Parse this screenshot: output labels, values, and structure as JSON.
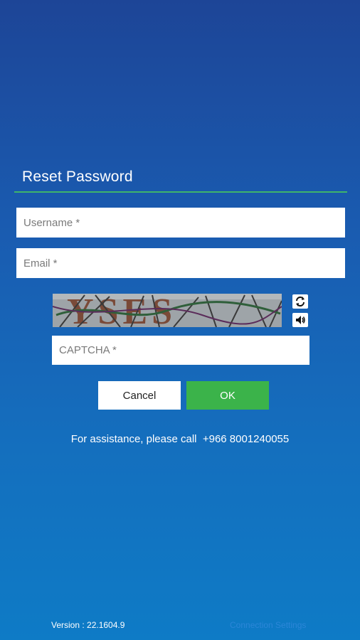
{
  "reset_form": {
    "title": "Reset Password",
    "username_placeholder": "Username *",
    "email_placeholder": "Email *",
    "captcha_placeholder": "CAPTCHA *",
    "captcha_text": "YSES",
    "cancel_label": "Cancel",
    "ok_label": "OK"
  },
  "assistance": {
    "text": "For assistance, please call  +966 8001240055"
  },
  "footer": {
    "version": "Version : 22.1604.9",
    "connection_settings": "Connection Settings"
  },
  "icons": {
    "refresh": "refresh-icon",
    "audio": "speaker-icon"
  },
  "colors": {
    "background_top": "#1d4597",
    "background_bottom": "#0e7bc6",
    "title_rule": "#3fb56a",
    "ok_button": "#3bb34a",
    "connection_settings_link": "#2b86d8"
  }
}
